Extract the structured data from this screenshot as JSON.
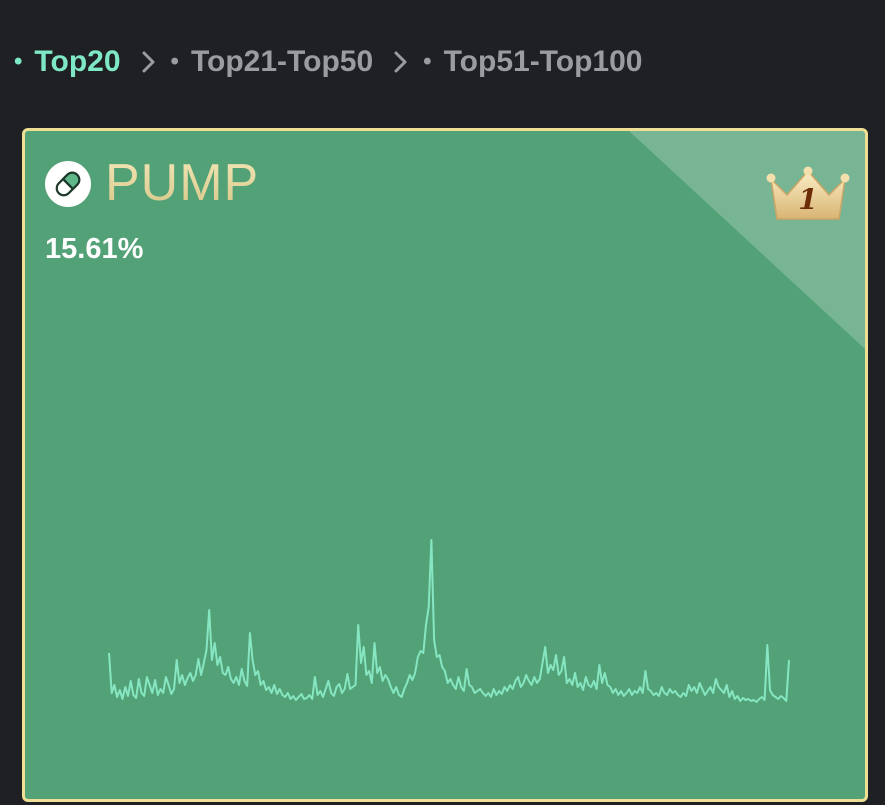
{
  "breadcrumb": {
    "items": [
      {
        "label": "Top20",
        "active": true
      },
      {
        "label": "Top21-Top50",
        "active": false
      },
      {
        "label": "Top51-Top100",
        "active": false
      }
    ],
    "separator_icon": "chevron-right-icon"
  },
  "card": {
    "coin_icon": "pill-capsule-icon",
    "coin_name": "PUMP",
    "change_percent": "15.61%",
    "rank": "1",
    "rank_icon": "crown-icon",
    "colors": {
      "background": "#52a177",
      "border": "#eedf95",
      "line": "#86e6c2",
      "active_crumb": "#7ee7c6"
    },
    "sparkline": [
      5.2,
      1.2,
      2.0,
      0.8,
      1.5,
      0.6,
      1.8,
      0.9,
      2.4,
      1.0,
      0.7,
      2.6,
      1.2,
      0.9,
      2.8,
      2.0,
      1.2,
      2.5,
      1.0,
      1.6,
      1.2,
      2.8,
      2.0,
      1.1,
      1.6,
      4.5,
      2.2,
      3.0,
      2.0,
      2.7,
      3.2,
      2.4,
      3.0,
      4.6,
      3.0,
      4.2,
      5.5,
      9.5,
      4.5,
      6.2,
      4.0,
      4.8,
      3.2,
      3.0,
      3.8,
      2.6,
      2.2,
      2.8,
      2.0,
      3.6,
      2.4,
      1.9,
      7.2,
      4.5,
      3.0,
      3.4,
      2.0,
      2.4,
      1.5,
      1.8,
      1.2,
      2.0,
      1.1,
      1.6,
      1.0,
      0.8,
      1.2,
      0.6,
      0.9,
      0.5,
      0.8,
      1.1,
      0.6,
      0.7,
      1.0,
      0.6,
      2.8,
      1.0,
      1.4,
      0.8,
      1.6,
      2.4,
      1.2,
      0.9,
      1.8,
      2.1,
      1.2,
      1.6,
      3.1,
      1.6,
      1.8,
      2.0,
      8.0,
      4.2,
      5.8,
      3.0,
      3.4,
      2.2,
      6.2,
      3.2,
      3.8,
      2.4,
      3.0,
      2.6,
      1.8,
      1.2,
      1.8,
      1.0,
      0.8,
      1.6,
      2.2,
      3.0,
      2.5,
      3.2,
      4.8,
      5.4,
      5.2,
      8.0,
      9.8,
      16.5,
      6.5,
      4.8,
      5.0,
      3.8,
      3.4,
      2.2,
      2.6,
      2.0,
      1.6,
      2.8,
      1.8,
      1.4,
      3.6,
      2.0,
      1.8,
      1.2,
      1.4,
      1.6,
      1.2,
      0.9,
      1.2,
      0.8,
      1.6,
      1.0,
      1.4,
      1.1,
      1.8,
      1.4,
      2.0,
      1.6,
      2.4,
      2.8,
      1.8,
      2.2,
      3.0,
      2.4,
      2.0,
      2.8,
      2.2,
      2.6,
      4.2,
      5.8,
      3.2,
      4.0,
      3.5,
      5.0,
      3.0,
      3.4,
      4.8,
      2.2,
      2.6,
      2.0,
      3.2,
      1.8,
      2.2,
      1.5,
      2.8,
      2.0,
      1.8,
      2.4,
      1.6,
      4.0,
      2.2,
      3.2,
      2.0,
      1.8,
      1.2,
      1.6,
      1.0,
      1.4,
      0.9,
      1.2,
      1.6,
      1.0,
      1.4,
      1.2,
      1.8,
      1.2,
      3.4,
      1.6,
      1.4,
      1.0,
      1.2,
      0.9,
      1.8,
      1.2,
      1.0,
      1.6,
      1.2,
      1.4,
      1.0,
      0.8,
      1.2,
      0.9,
      2.0,
      1.4,
      1.8,
      1.2,
      2.2,
      1.6,
      1.0,
      1.4,
      1.8,
      1.2,
      2.6,
      1.8,
      1.5,
      1.2,
      2.0,
      0.8,
      1.4,
      0.6,
      0.9,
      0.4,
      0.7,
      0.5,
      0.6,
      0.4,
      0.5,
      0.3,
      0.6,
      0.8,
      0.5,
      6.0,
      1.5,
      1.0,
      0.8,
      0.6,
      0.9,
      0.7,
      0.4,
      4.5
    ]
  }
}
